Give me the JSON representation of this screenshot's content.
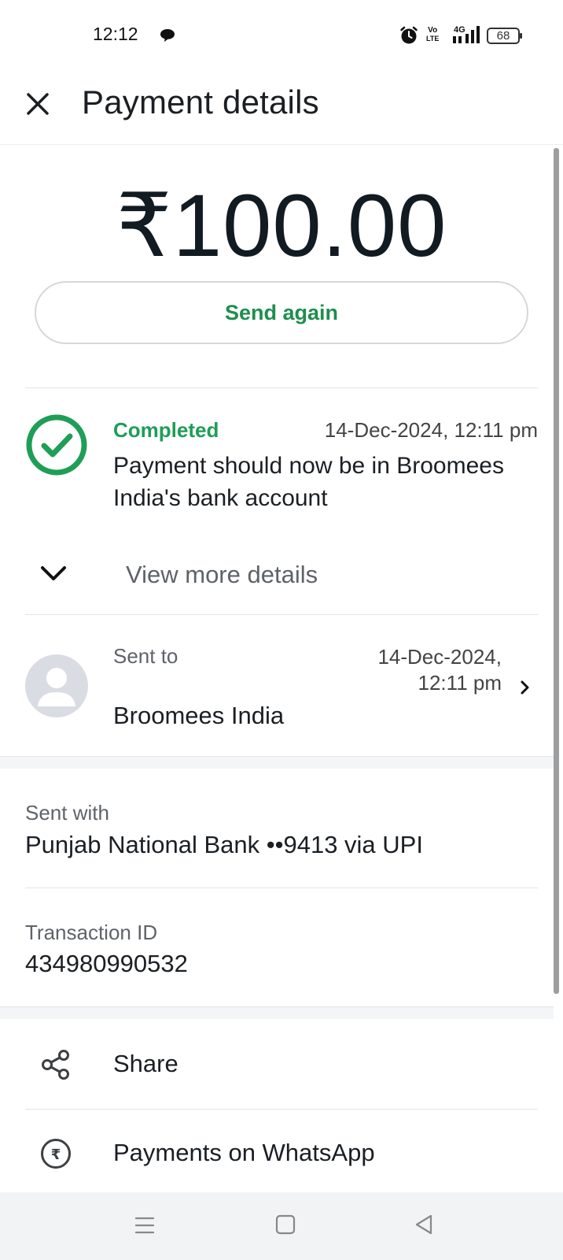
{
  "status_bar": {
    "time": "12:12",
    "volte_line1": "Vo",
    "volte_line2": "LTE",
    "network": "4G",
    "battery": "68"
  },
  "header": {
    "title": "Payment details"
  },
  "payment": {
    "amount": "₹100.00",
    "send_again_label": "Send again"
  },
  "status": {
    "label": "Completed",
    "datetime": "14-Dec-2024, 12:11 pm",
    "message": "Payment should now be in Broomees India's bank account",
    "color": "#1e9e57"
  },
  "view_more": {
    "label": "View more details"
  },
  "recipient": {
    "sent_to_label": "Sent to",
    "date_line1": "14-Dec-2024,",
    "date_line2": "12:11 pm",
    "name": "Broomees India"
  },
  "sent_with": {
    "label": "Sent with",
    "value": "Punjab National Bank ••9413 via UPI"
  },
  "transaction": {
    "label": "Transaction ID",
    "value": "434980990532"
  },
  "actions": [
    {
      "label": "Share",
      "icon": "share-icon"
    },
    {
      "label": "Payments on WhatsApp",
      "icon": "rupee-circle-icon"
    }
  ],
  "nav": {
    "icons": [
      "menu-icon",
      "home-icon",
      "back-icon"
    ]
  }
}
